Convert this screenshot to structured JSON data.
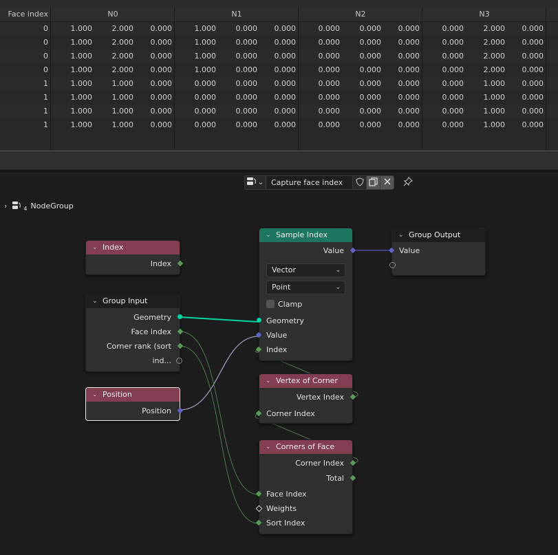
{
  "spreadsheet": {
    "columns": [
      {
        "label": "Face index"
      },
      {
        "label": "N0"
      },
      {
        "label": "N1"
      },
      {
        "label": "N2"
      },
      {
        "label": "N3"
      }
    ],
    "rows": [
      {
        "face_index": "0",
        "n0": [
          "1.000",
          "2.000",
          "0.000"
        ],
        "n1": [
          "1.000",
          "0.000",
          "0.000"
        ],
        "n2": [
          "0.000",
          "0.000",
          "0.000"
        ],
        "n3": [
          "0.000",
          "2.000",
          "0.000"
        ]
      },
      {
        "face_index": "0",
        "n0": [
          "1.000",
          "2.000",
          "0.000"
        ],
        "n1": [
          "1.000",
          "0.000",
          "0.000"
        ],
        "n2": [
          "0.000",
          "0.000",
          "0.000"
        ],
        "n3": [
          "0.000",
          "2.000",
          "0.000"
        ]
      },
      {
        "face_index": "0",
        "n0": [
          "1.000",
          "2.000",
          "0.000"
        ],
        "n1": [
          "1.000",
          "0.000",
          "0.000"
        ],
        "n2": [
          "0.000",
          "0.000",
          "0.000"
        ],
        "n3": [
          "0.000",
          "2.000",
          "0.000"
        ]
      },
      {
        "face_index": "0",
        "n0": [
          "1.000",
          "2.000",
          "0.000"
        ],
        "n1": [
          "1.000",
          "0.000",
          "0.000"
        ],
        "n2": [
          "0.000",
          "0.000",
          "0.000"
        ],
        "n3": [
          "0.000",
          "2.000",
          "0.000"
        ]
      },
      {
        "face_index": "1",
        "n0": [
          "1.000",
          "1.000",
          "0.000"
        ],
        "n1": [
          "0.000",
          "0.000",
          "0.000"
        ],
        "n2": [
          "0.000",
          "0.000",
          "0.000"
        ],
        "n3": [
          "0.000",
          "1.000",
          "0.000"
        ]
      },
      {
        "face_index": "1",
        "n0": [
          "1.000",
          "1.000",
          "0.000"
        ],
        "n1": [
          "0.000",
          "0.000",
          "0.000"
        ],
        "n2": [
          "0.000",
          "0.000",
          "0.000"
        ],
        "n3": [
          "0.000",
          "1.000",
          "0.000"
        ]
      },
      {
        "face_index": "1",
        "n0": [
          "1.000",
          "1.000",
          "0.000"
        ],
        "n1": [
          "0.000",
          "0.000",
          "0.000"
        ],
        "n2": [
          "0.000",
          "0.000",
          "0.000"
        ],
        "n3": [
          "0.000",
          "1.000",
          "0.000"
        ]
      },
      {
        "face_index": "1",
        "n0": [
          "1.000",
          "1.000",
          "0.000"
        ],
        "n1": [
          "0.000",
          "0.000",
          "0.000"
        ],
        "n2": [
          "0.000",
          "0.000",
          "0.000"
        ],
        "n3": [
          "0.000",
          "1.000",
          "0.000"
        ]
      }
    ]
  },
  "node_editor": {
    "node_tree_name": "Capture face index",
    "icons": {
      "tree_type": "node-tree-icon",
      "fake_user": "shield-icon",
      "duplicate": "duplicate-icon",
      "unlink": "close-icon",
      "pin": "pin-icon"
    },
    "breadcrumb": {
      "label": "NodeGroup",
      "user_count": "4"
    },
    "colors": {
      "input_header": "#843e52",
      "attribute_header": "#1f7660",
      "group_header": "#1e1e1e",
      "integer_socket": "#5a9a5a",
      "geometry_socket": "#00d6a3",
      "vector_socket": "#6363c7"
    },
    "nodes": {
      "index": {
        "title": "Index",
        "outputs": [
          "Index"
        ]
      },
      "group_input": {
        "title": "Group Input",
        "outputs": [
          "Geometry",
          "Face index",
          "Corner rank (sort ind..."
        ]
      },
      "position": {
        "title": "Position",
        "outputs": [
          "Position"
        ]
      },
      "sample_index": {
        "title": "Sample Index",
        "outputs": [
          "Value"
        ],
        "data_type": "Vector",
        "domain": "Point",
        "clamp_label": "Clamp",
        "clamp_checked": false,
        "inputs": [
          "Geometry",
          "Value",
          "Index"
        ]
      },
      "group_output": {
        "title": "Group Output",
        "inputs": [
          "Value"
        ]
      },
      "vertex_of_corner": {
        "title": "Vertex of Corner",
        "outputs": [
          "Vertex Index"
        ],
        "inputs": [
          "Corner Index"
        ]
      },
      "corners_of_face": {
        "title": "Corners of Face",
        "outputs": [
          "Corner Index",
          "Total"
        ],
        "inputs": [
          "Face Index",
          "Weights",
          "Sort Index"
        ]
      }
    }
  }
}
